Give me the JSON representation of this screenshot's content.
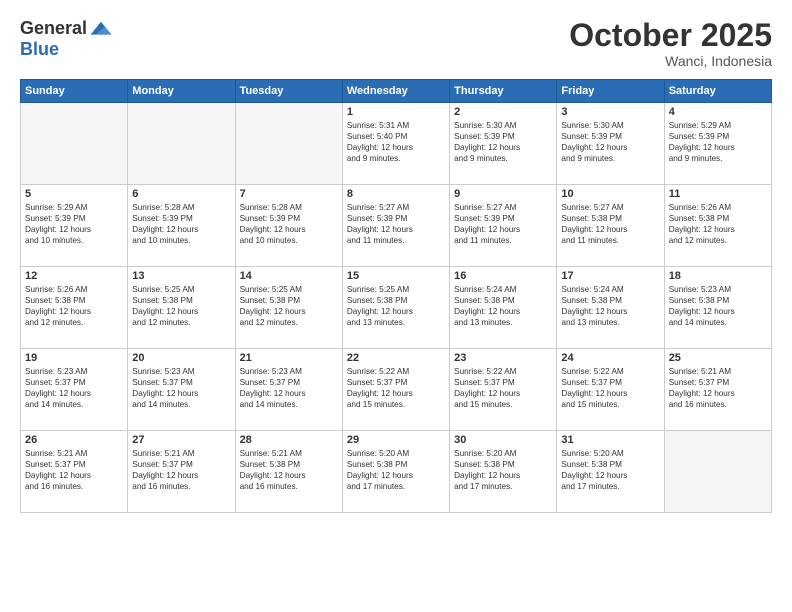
{
  "header": {
    "logo_general": "General",
    "logo_blue": "Blue",
    "month_title": "October 2025",
    "subtitle": "Wanci, Indonesia"
  },
  "weekdays": [
    "Sunday",
    "Monday",
    "Tuesday",
    "Wednesday",
    "Thursday",
    "Friday",
    "Saturday"
  ],
  "weeks": [
    [
      {
        "day": "",
        "text": ""
      },
      {
        "day": "",
        "text": ""
      },
      {
        "day": "",
        "text": ""
      },
      {
        "day": "1",
        "text": "Sunrise: 5:31 AM\nSunset: 5:40 PM\nDaylight: 12 hours\nand 9 minutes."
      },
      {
        "day": "2",
        "text": "Sunrise: 5:30 AM\nSunset: 5:39 PM\nDaylight: 12 hours\nand 9 minutes."
      },
      {
        "day": "3",
        "text": "Sunrise: 5:30 AM\nSunset: 5:39 PM\nDaylight: 12 hours\nand 9 minutes."
      },
      {
        "day": "4",
        "text": "Sunrise: 5:29 AM\nSunset: 5:39 PM\nDaylight: 12 hours\nand 9 minutes."
      }
    ],
    [
      {
        "day": "5",
        "text": "Sunrise: 5:29 AM\nSunset: 5:39 PM\nDaylight: 12 hours\nand 10 minutes."
      },
      {
        "day": "6",
        "text": "Sunrise: 5:28 AM\nSunset: 5:39 PM\nDaylight: 12 hours\nand 10 minutes."
      },
      {
        "day": "7",
        "text": "Sunrise: 5:28 AM\nSunset: 5:39 PM\nDaylight: 12 hours\nand 10 minutes."
      },
      {
        "day": "8",
        "text": "Sunrise: 5:27 AM\nSunset: 5:39 PM\nDaylight: 12 hours\nand 11 minutes."
      },
      {
        "day": "9",
        "text": "Sunrise: 5:27 AM\nSunset: 5:39 PM\nDaylight: 12 hours\nand 11 minutes."
      },
      {
        "day": "10",
        "text": "Sunrise: 5:27 AM\nSunset: 5:38 PM\nDaylight: 12 hours\nand 11 minutes."
      },
      {
        "day": "11",
        "text": "Sunrise: 5:26 AM\nSunset: 5:38 PM\nDaylight: 12 hours\nand 12 minutes."
      }
    ],
    [
      {
        "day": "12",
        "text": "Sunrise: 5:26 AM\nSunset: 5:38 PM\nDaylight: 12 hours\nand 12 minutes."
      },
      {
        "day": "13",
        "text": "Sunrise: 5:25 AM\nSunset: 5:38 PM\nDaylight: 12 hours\nand 12 minutes."
      },
      {
        "day": "14",
        "text": "Sunrise: 5:25 AM\nSunset: 5:38 PM\nDaylight: 12 hours\nand 12 minutes."
      },
      {
        "day": "15",
        "text": "Sunrise: 5:25 AM\nSunset: 5:38 PM\nDaylight: 12 hours\nand 13 minutes."
      },
      {
        "day": "16",
        "text": "Sunrise: 5:24 AM\nSunset: 5:38 PM\nDaylight: 12 hours\nand 13 minutes."
      },
      {
        "day": "17",
        "text": "Sunrise: 5:24 AM\nSunset: 5:38 PM\nDaylight: 12 hours\nand 13 minutes."
      },
      {
        "day": "18",
        "text": "Sunrise: 5:23 AM\nSunset: 5:38 PM\nDaylight: 12 hours\nand 14 minutes."
      }
    ],
    [
      {
        "day": "19",
        "text": "Sunrise: 5:23 AM\nSunset: 5:37 PM\nDaylight: 12 hours\nand 14 minutes."
      },
      {
        "day": "20",
        "text": "Sunrise: 5:23 AM\nSunset: 5:37 PM\nDaylight: 12 hours\nand 14 minutes."
      },
      {
        "day": "21",
        "text": "Sunrise: 5:23 AM\nSunset: 5:37 PM\nDaylight: 12 hours\nand 14 minutes."
      },
      {
        "day": "22",
        "text": "Sunrise: 5:22 AM\nSunset: 5:37 PM\nDaylight: 12 hours\nand 15 minutes."
      },
      {
        "day": "23",
        "text": "Sunrise: 5:22 AM\nSunset: 5:37 PM\nDaylight: 12 hours\nand 15 minutes."
      },
      {
        "day": "24",
        "text": "Sunrise: 5:22 AM\nSunset: 5:37 PM\nDaylight: 12 hours\nand 15 minutes."
      },
      {
        "day": "25",
        "text": "Sunrise: 5:21 AM\nSunset: 5:37 PM\nDaylight: 12 hours\nand 16 minutes."
      }
    ],
    [
      {
        "day": "26",
        "text": "Sunrise: 5:21 AM\nSunset: 5:37 PM\nDaylight: 12 hours\nand 16 minutes."
      },
      {
        "day": "27",
        "text": "Sunrise: 5:21 AM\nSunset: 5:37 PM\nDaylight: 12 hours\nand 16 minutes."
      },
      {
        "day": "28",
        "text": "Sunrise: 5:21 AM\nSunset: 5:38 PM\nDaylight: 12 hours\nand 16 minutes."
      },
      {
        "day": "29",
        "text": "Sunrise: 5:20 AM\nSunset: 5:38 PM\nDaylight: 12 hours\nand 17 minutes."
      },
      {
        "day": "30",
        "text": "Sunrise: 5:20 AM\nSunset: 5:38 PM\nDaylight: 12 hours\nand 17 minutes."
      },
      {
        "day": "31",
        "text": "Sunrise: 5:20 AM\nSunset: 5:38 PM\nDaylight: 12 hours\nand 17 minutes."
      },
      {
        "day": "",
        "text": ""
      }
    ]
  ]
}
